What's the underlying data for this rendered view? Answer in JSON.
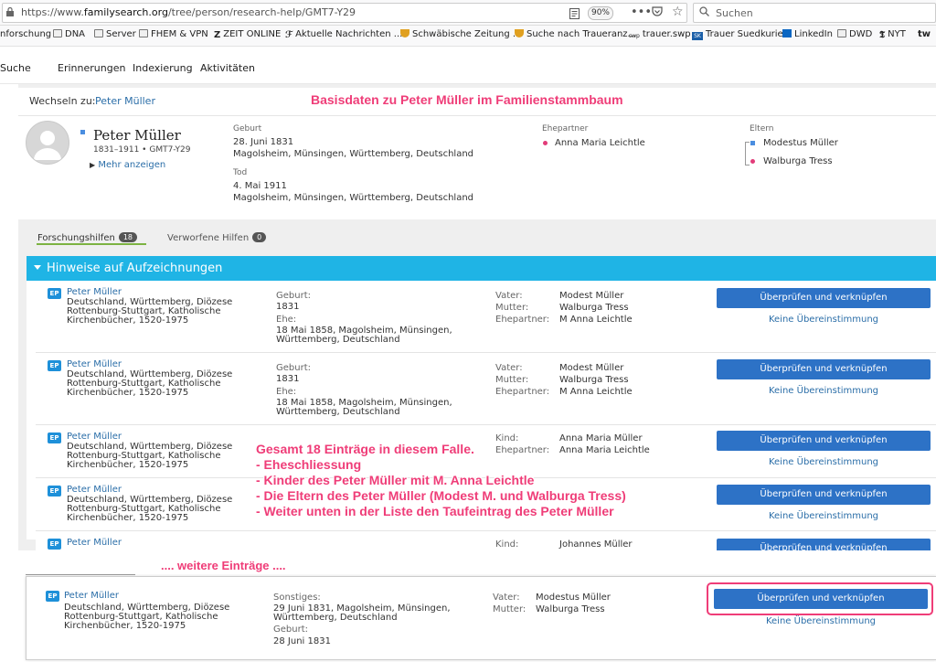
{
  "browser": {
    "url_prefix": "https://www.",
    "url_domain": "familysearch.org",
    "url_path": "/tree/person/research-help/GMT7-Y29",
    "zoom": "90%",
    "search_placeholder": "Suchen",
    "bookmarks": [
      "nforschung",
      "DNA",
      "Server",
      "FHEM & VPN",
      "ZEIT ONLINE",
      "Aktuelle Nachrichten ...",
      "Schwäbische Zeitung ...",
      "Suche nach Traueranz...",
      "trauer.swp",
      "Trauer Suedkurier",
      "LinkedIn",
      "DWD",
      "NYT",
      "tw"
    ]
  },
  "nav": [
    "Suche",
    "Erinnerungen",
    "Indexierung",
    "Aktivitäten"
  ],
  "switch": {
    "label": "Wechseln zu:",
    "value": "Peter Müller"
  },
  "person": {
    "name": "Peter Müller",
    "dates_id": "1831–1911 • GMT7-Y29",
    "more": "Mehr anzeigen",
    "birth_label": "Geburt",
    "birth_date": "28. Juni 1831",
    "birth_place": "Magolsheim, Münsingen, Württemberg, Deutschland",
    "death_label": "Tod",
    "death_date": "4. Mai 1911",
    "death_place": "Magolsheim, Münsingen, Württemberg, Deutschland",
    "spouse_label": "Ehepartner",
    "spouse": "Anna Maria Leichtle",
    "parents_label": "Eltern",
    "father": "Modestus Müller",
    "mother": "Walburga Tress"
  },
  "tabs": {
    "research": "Forschungshilfen",
    "research_count": "18",
    "discarded": "Verworfene Hilfen",
    "discarded_count": "0"
  },
  "section_title": "Hinweise auf Aufzeichnungen",
  "button_label": "Überprüfen und verknüpfen",
  "nomatch_label": "Keine Übereinstimmung",
  "record_badge": "EP",
  "records": [
    {
      "name": "Peter Müller",
      "coll": "Deutschland, Württemberg, Diözese Rottenburg-Stuttgart, Katholische Kirchenbücher, 1520-1975",
      "ev1_label": "Geburt:",
      "ev1_val": "1831",
      "ev2_label": "Ehe:",
      "ev2_val": "18 Mai 1858, Magolsheim, Münsingen, Württemberg, Deutschland",
      "r1_label": "Vater:",
      "r1_val": "Modest Müller",
      "r2_label": "Mutter:",
      "r2_val": "Walburga Tress",
      "r3_label": "Ehepartner:",
      "r3_val": "M Anna Leichtle"
    },
    {
      "name": "Peter Müller",
      "coll": "Deutschland, Württemberg, Diözese Rottenburg-Stuttgart, Katholische Kirchenbücher, 1520-1975",
      "ev1_label": "Geburt:",
      "ev1_val": "1831",
      "ev2_label": "Ehe:",
      "ev2_val": "18 Mai 1858, Magolsheim, Münsingen, Württemberg, Deutschland",
      "r1_label": "Vater:",
      "r1_val": "Modest Müller",
      "r2_label": "Mutter:",
      "r2_val": "Walburga Tress",
      "r3_label": "Ehepartner:",
      "r3_val": "M Anna Leichtle"
    },
    {
      "name": "Peter Müller",
      "coll": "Deutschland, Württemberg, Diözese Rottenburg-Stuttgart, Katholische Kirchenbücher, 1520-1975",
      "r1_label": "Kind:",
      "r1_val": "Anna Maria Müller",
      "r2_label": "Ehepartner:",
      "r2_val": "Anna Maria Leichtle"
    },
    {
      "name": "Peter Müller",
      "coll": "Deutschland, Württemberg, Diözese Rottenburg-Stuttgart, Katholische Kirchenbücher, 1520-1975"
    },
    {
      "name": "Peter Müller",
      "r1_label": "Kind:",
      "r1_val": "Johannes Müller"
    }
  ],
  "last_record": {
    "name": "Peter Müller",
    "coll": "Deutschland, Württemberg, Diözese Rottenburg-Stuttgart, Katholische Kirchenbücher, 1520-1975",
    "ev1_label": "Sonstiges:",
    "ev1_val": "29 Juni 1831, Magolsheim, Münsingen, Württemberg, Deutschland",
    "ev2_label": "Geburt:",
    "ev2_val": "28 Juni 1831",
    "r1_label": "Vater:",
    "r1_val": "Modestus Müller",
    "r2_label": "Mutter:",
    "r2_val": "Walburga Tress"
  },
  "annotations": {
    "top": "Basisdaten zu Peter Müller im Familienstammbaum",
    "mid": [
      "Gesamt 18 Einträge in diesem Falle.",
      "- Eheschliessung",
      "- Kinder des Peter Müller mit M. Anna Leichtle",
      "- Die Eltern des Peter Müller (Modest M. und Walburga Tress)",
      "- Weiter unten in der Liste den Taufeintrag des Peter Müller"
    ],
    "more": ".... weitere Einträge ...."
  },
  "colors": {
    "accent": "#1fb4e5",
    "button": "#2d72c6",
    "annotation": "#ef3d78",
    "link": "#2b6ea8"
  }
}
